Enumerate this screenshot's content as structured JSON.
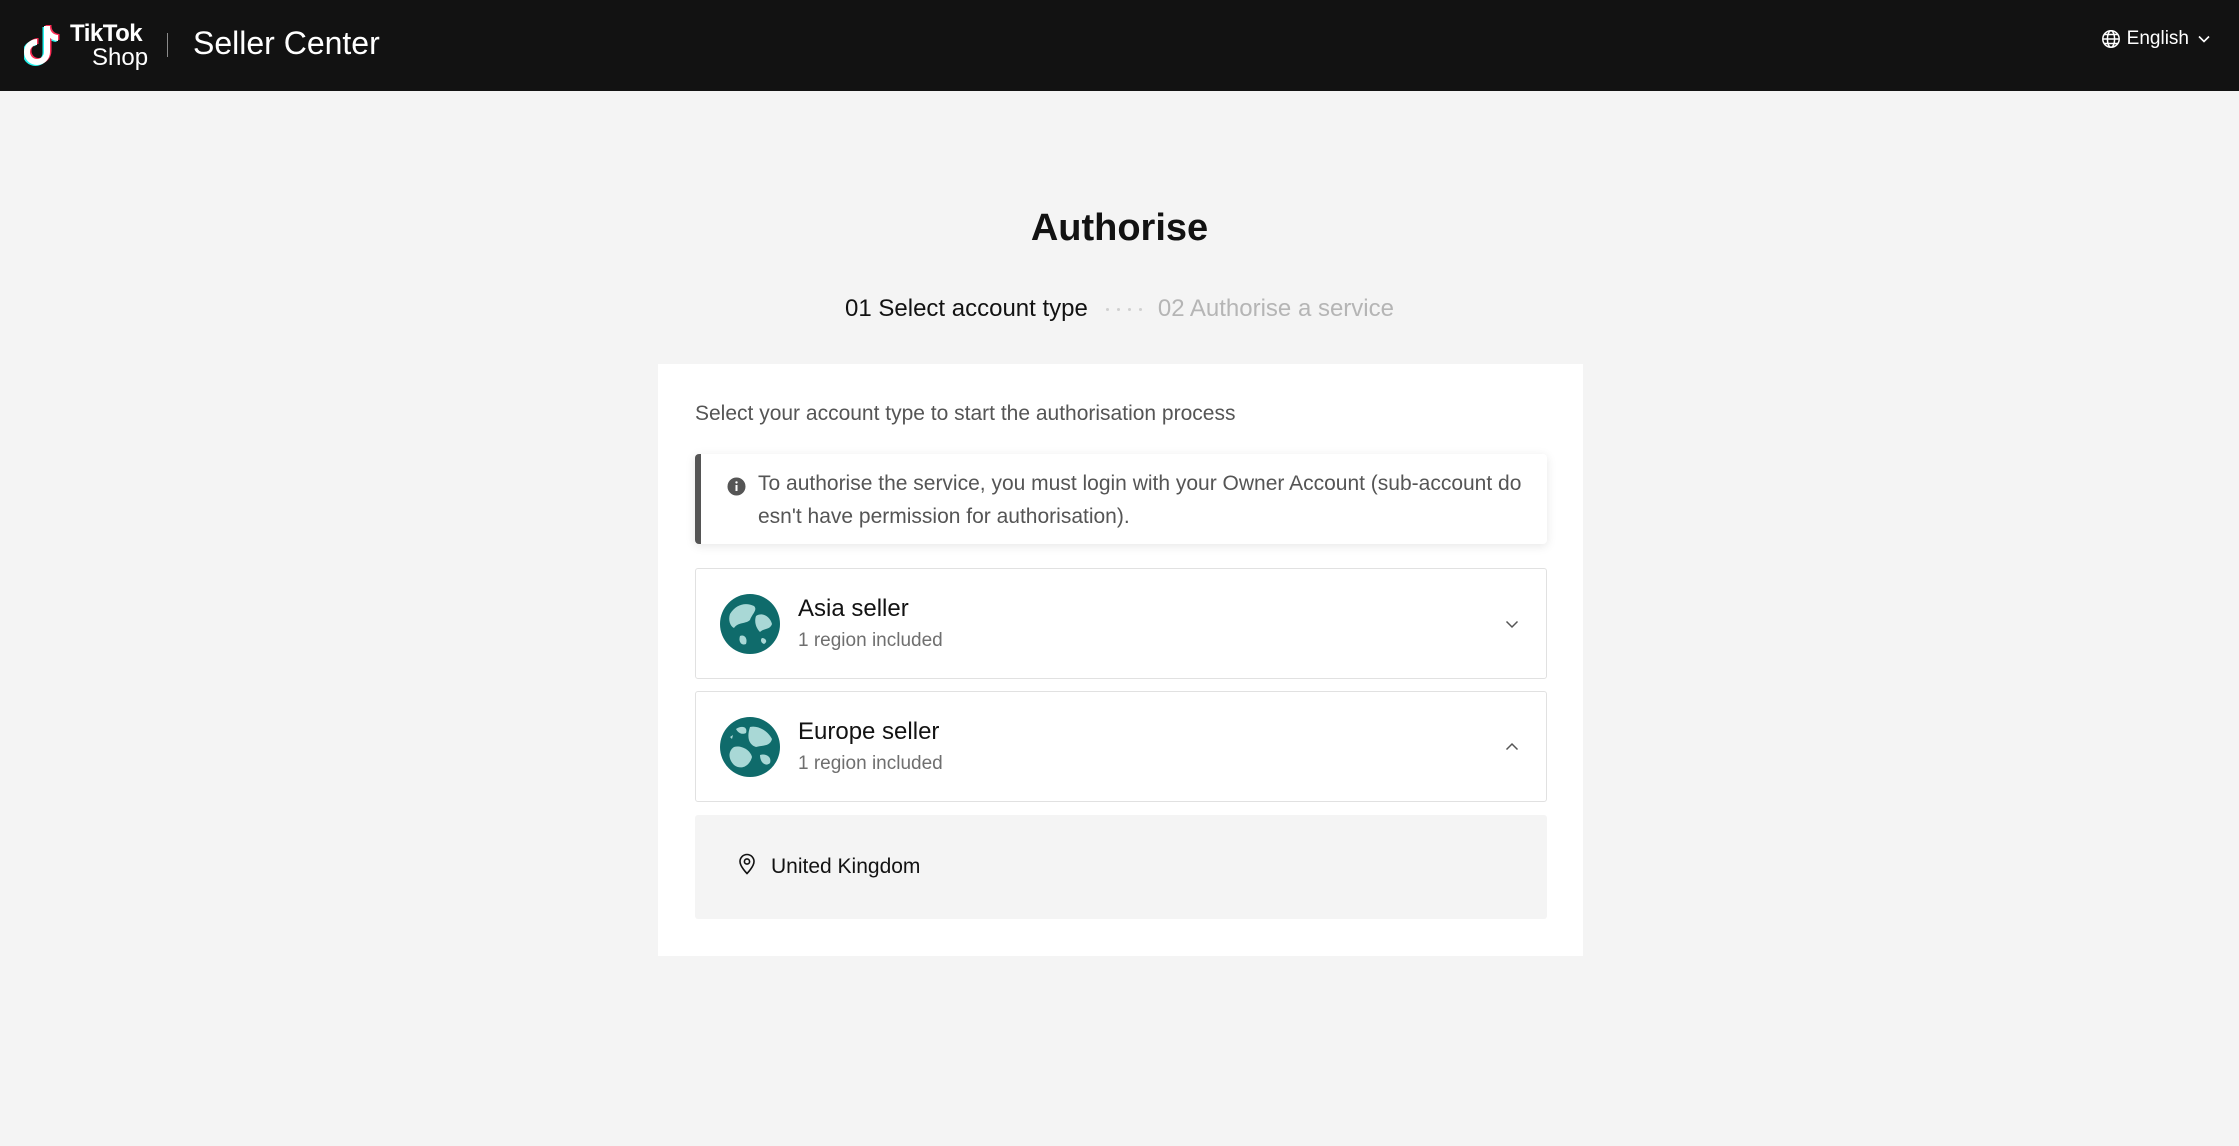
{
  "header": {
    "logo_line1": "TikTok",
    "logo_line2": "Shop",
    "app_title": "Seller Center",
    "language": "English",
    "icons": {
      "logo": "tiktok-logo-icon",
      "language": "globe-icon",
      "language_dropdown": "chevron-down-icon"
    }
  },
  "main": {
    "title": "Authorise",
    "steps": [
      {
        "label": "01 Select account type",
        "state": "active"
      },
      {
        "label": "02 Authorise a service",
        "state": "inactive"
      }
    ],
    "intro": "Select your account type to start the authorisation process",
    "notice": "To authorise the service, you must login with your Owner Account (sub-account doesn't have permission for authorisation).",
    "accounts": [
      {
        "name": "Asia seller",
        "sub": "1 region included",
        "expanded": false,
        "icon": "globe-asia-icon"
      },
      {
        "name": "Europe seller",
        "sub": "1 region included",
        "expanded": true,
        "icon": "globe-europe-icon"
      }
    ],
    "regions": [
      {
        "name": "United Kingdom",
        "icon": "location-pin-icon"
      }
    ]
  },
  "colors": {
    "header_bg": "#121212",
    "page_bg": "#f4f4f4",
    "globe_teal": "#0f6b6b",
    "globe_land": "#a9d8d6",
    "notice_border": "#555555"
  }
}
